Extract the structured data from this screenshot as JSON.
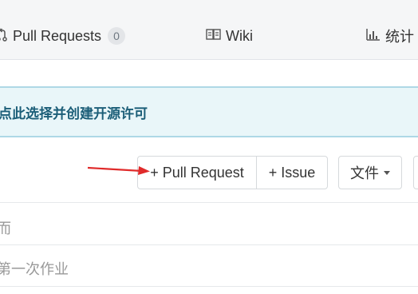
{
  "tabs": {
    "pull_requests": {
      "label": "Pull Requests",
      "count": "0"
    },
    "wiki": {
      "label": "Wiki"
    },
    "stats": {
      "label": "统计"
    }
  },
  "banner": {
    "text": "点此选择并创建开源许可"
  },
  "toolbar": {
    "new_pull_request": "+ Pull Request",
    "new_issue": "+ Issue",
    "files_dropdown": "文件"
  },
  "file_list": {
    "header": "而",
    "rows": [
      "第一次作业"
    ]
  },
  "annotation": {
    "arrow_color": "#e02b2b"
  },
  "icons": {
    "pull_request": "pull-request-icon",
    "wiki": "book-icon",
    "stats": "bar-chart-icon",
    "dropdown": "caret-down-icon"
  }
}
